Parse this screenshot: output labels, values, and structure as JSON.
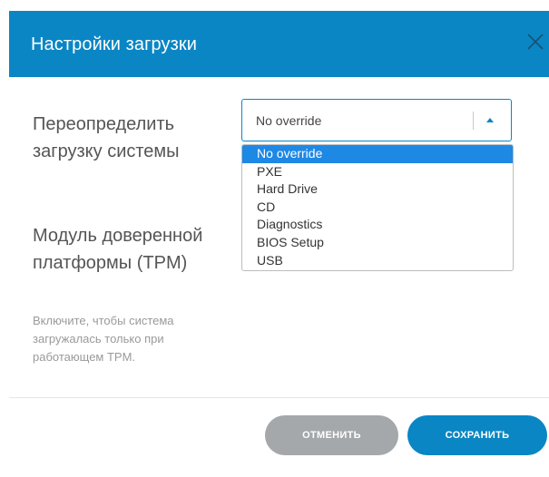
{
  "header": {
    "title": "Настройки загрузки",
    "close_icon": "close-icon"
  },
  "boot_override": {
    "label": "Переопределить загрузку системы",
    "selected_value": "No override",
    "options": [
      "No override",
      "PXE",
      "Hard Drive",
      "CD",
      "Diagnostics",
      "BIOS Setup",
      "USB"
    ],
    "selected_index": 0
  },
  "tpm": {
    "label": "Модуль доверенной платформы (TPM)",
    "description": "Включите, чтобы система загружалась только при работающем TPM."
  },
  "footer": {
    "cancel_label": "ОТМЕНИТЬ",
    "save_label": "СОХРАНИТЬ"
  },
  "colors": {
    "accent": "#0a86c4",
    "selected_option_bg": "#1e88e5",
    "cancel_button": "#a4a8ab"
  }
}
